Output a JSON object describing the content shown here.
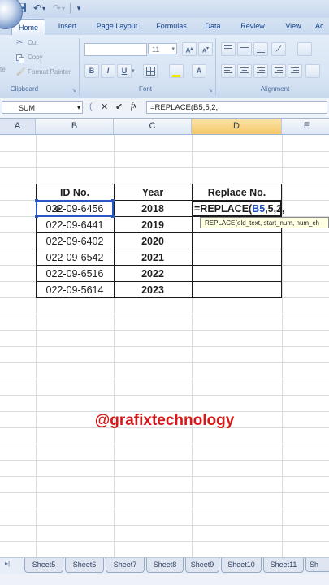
{
  "qat": {
    "undo_glyph": "↶",
    "redo_glyph": "↷",
    "more_glyph": "▾"
  },
  "tabs": [
    "Home",
    "Insert",
    "Page Layout",
    "Formulas",
    "Data",
    "Review",
    "View",
    "Ac"
  ],
  "ribbon": {
    "clipboard": {
      "paste_label": "te",
      "cut": "Cut",
      "copy": "Copy",
      "format_painter": "Format Painter",
      "group": "Clipboard"
    },
    "font": {
      "size": "11",
      "bold": "B",
      "italic": "I",
      "underline": "U",
      "group": "Font"
    },
    "alignment": {
      "group": "Alignment"
    }
  },
  "formula_bar": {
    "name_box": "SUM",
    "cancel": "✕",
    "enter": "✔",
    "fx": "fx",
    "formula": "=REPLACE(B5,5,2,"
  },
  "columns": [
    "A",
    "B",
    "C",
    "D",
    "E"
  ],
  "table": {
    "headers": [
      "ID No.",
      "Year",
      "Replace No."
    ],
    "rows": [
      {
        "id": "022-09-6456",
        "year": "2018"
      },
      {
        "id": "022-09-6441",
        "year": "2019"
      },
      {
        "id": "022-09-6402",
        "year": "2020"
      },
      {
        "id": "022-09-6542",
        "year": "2021"
      },
      {
        "id": "022-09-6516",
        "year": "2022"
      },
      {
        "id": "022-09-5614",
        "year": "2023"
      }
    ],
    "active_formula": {
      "prefix": "=REPLACE(",
      "ref": "B5",
      "suffix": ",5,2,"
    },
    "tooltip": "REPLACE(old_text, start_num, num_ch"
  },
  "watermark": "@grafixtechnology",
  "sheets": [
    "Sheet5",
    "Sheet6",
    "Sheet7",
    "Sheet8",
    "Sheet9",
    "Sheet10",
    "Sheet11",
    "Sh"
  ],
  "colors": {
    "accent": "#15428b",
    "watermark": "#d81818",
    "ref_blue": "#1f4fbf"
  }
}
